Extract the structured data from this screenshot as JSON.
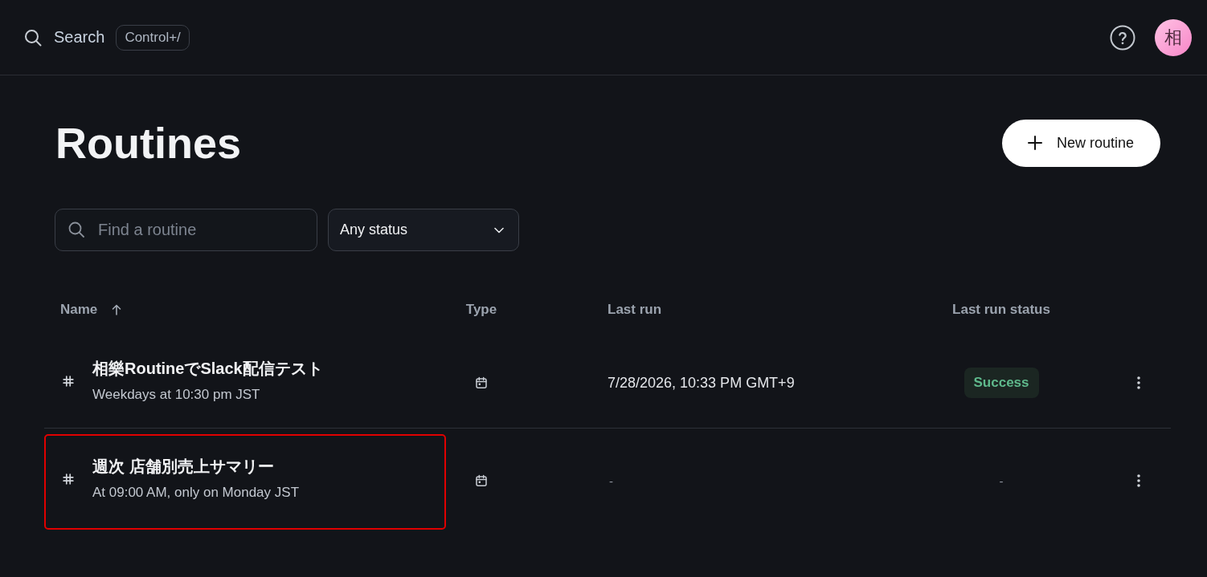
{
  "topbar": {
    "search_label": "Search",
    "shortcut": "Control+/",
    "avatar": "相"
  },
  "page": {
    "title": "Routines",
    "new_button": "New routine"
  },
  "filters": {
    "search": {
      "placeholder": "Find a routine"
    },
    "status_select": {
      "value": "Any status"
    }
  },
  "table": {
    "columns": [
      {
        "label": "Name",
        "sorted": true
      },
      {
        "label": "Type",
        "sorted": false
      },
      {
        "label": "Last run",
        "sorted": false
      },
      {
        "label": "Last run status",
        "sorted": false
      }
    ],
    "rows": [
      {
        "name": "相樂RoutineでSlack配信テスト",
        "schedule": "Weekdays at 10:30 pm JST",
        "type": {
          "kind": "scheduled"
        },
        "last_run": "7/28/2026, 10:33 PM GMT+9",
        "status": {
          "kind": "success",
          "label": "Success"
        },
        "highlighted": false
      },
      {
        "name": "週次 店舗別売上サマリー",
        "schedule": "At 09:00 AM, only on Monday JST",
        "type": {
          "kind": "scheduled"
        },
        "last_run": "-",
        "status": {
          "kind": "none",
          "label": "-"
        },
        "highlighted": true
      }
    ]
  }
}
